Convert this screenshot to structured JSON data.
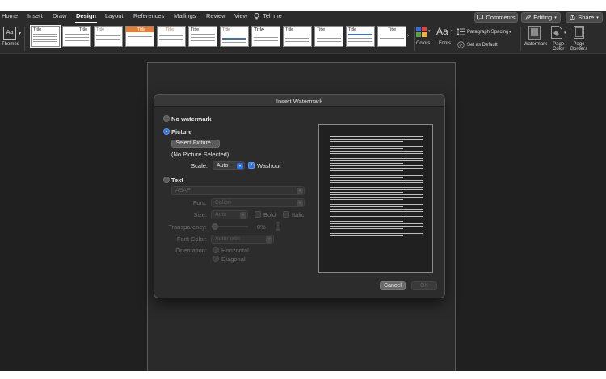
{
  "ribbon_tabs": [
    {
      "label": "Home"
    },
    {
      "label": "Insert"
    },
    {
      "label": "Draw"
    },
    {
      "label": "Design",
      "active": true
    },
    {
      "label": "Layout"
    },
    {
      "label": "References"
    },
    {
      "label": "Mailings"
    },
    {
      "label": "Review"
    },
    {
      "label": "View"
    }
  ],
  "tell_me": "Tell me",
  "top_buttons": {
    "comments": "Comments",
    "editing": "Editing",
    "share": "Share"
  },
  "ribbon": {
    "themes_label": "Themes",
    "thumb_titles": [
      "Title",
      "Title",
      "Title",
      "Title",
      "Title",
      "Title",
      "Title",
      "Title",
      "Title",
      "Title",
      "Title",
      "Title"
    ],
    "colors_label": "Colors",
    "fonts_label": "Fonts",
    "paragraph_spacing_label": "Paragraph Spacing",
    "set_as_default_label": "Set as Default",
    "watermark_label": "Watermark",
    "page_color_label": "Page\nColor",
    "page_borders_label": "Page\nBorders",
    "fonts_glyph": "Aa"
  },
  "dialog": {
    "title": "Insert Watermark",
    "no_watermark_label": "No watermark",
    "picture_label": "Picture",
    "select_picture_label": "Select Picture...",
    "no_picture_selected": "(No Picture Selected)",
    "scale_label": "Scale:",
    "scale_value": "Auto",
    "washout_label": "Washout",
    "text_label": "Text",
    "text_value": "ASAP",
    "font_label": "Font:",
    "font_value": "Calibri",
    "size_label": "Size:",
    "size_value": "Auto",
    "bold_label": "Bold",
    "italic_label": "Italic",
    "transparency_label": "Transparency:",
    "transparency_value": "0%",
    "font_color_label": "Font Color:",
    "font_color_value": "Automatic",
    "orientation_label": "Orientation:",
    "horizontal_label": "Horizontal",
    "diagonal_label": "Diagonal",
    "selected_option": "Picture",
    "cancel_label": "Cancel",
    "ok_label": "OK"
  },
  "colors": {
    "accent_blue": "#2f6fe0",
    "dialog_bg": "#2c2c2c",
    "ribbon_bg": "#2b2b2b"
  }
}
